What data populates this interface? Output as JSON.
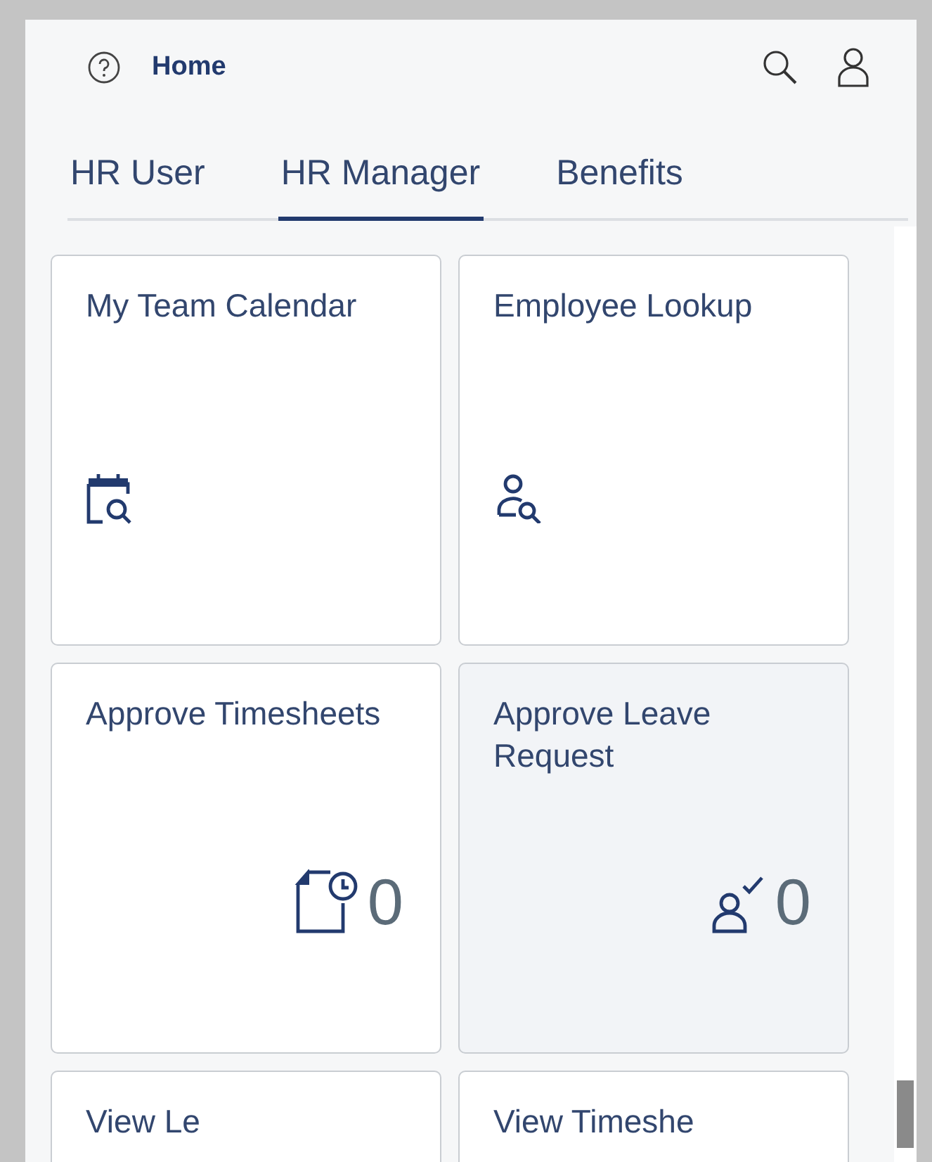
{
  "header": {
    "title": "Home"
  },
  "tabs": [
    {
      "label": "HR User",
      "selected": false
    },
    {
      "label": "HR Manager",
      "selected": true
    },
    {
      "label": "Benefits",
      "selected": false
    }
  ],
  "tiles": [
    {
      "title": "My Team Calendar",
      "hovered": false
    },
    {
      "title": "Employee Lookup",
      "hovered": false
    },
    {
      "title": "Approve Timesheets",
      "count": "0",
      "hovered": false
    },
    {
      "title": "Approve Leave Request",
      "count": "0",
      "hovered": true
    },
    {
      "title": "View Le",
      "hovered": false
    },
    {
      "title": "View Timeshe",
      "hovered": false
    }
  ]
}
